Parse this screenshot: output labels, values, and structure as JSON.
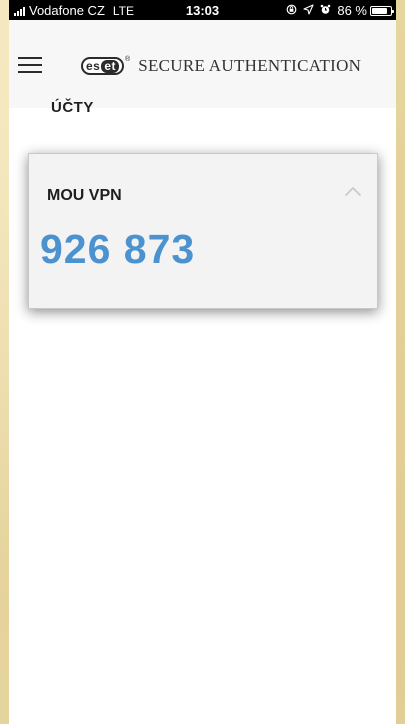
{
  "status_bar": {
    "carrier": "Vodafone CZ",
    "network": "LTE",
    "time": "13:03",
    "icons": [
      "screen-rotation-lock-icon",
      "location-arrow-icon",
      "alarm-icon"
    ],
    "battery_percent": "86 %",
    "battery_level": 0.86
  },
  "header": {
    "logo_es": "es",
    "logo_et": "et",
    "logo_reg": "®",
    "title": "SECURE AUTHENTICATION",
    "menu_icon": "hamburger-menu-icon"
  },
  "accounts": {
    "section_title": "ÚČTY",
    "items": [
      {
        "name": "MOU VPN",
        "code": "926 873",
        "expanded": true
      }
    ]
  },
  "colors": {
    "code_color": "#4b92cf",
    "status_bar_bg": "#000000",
    "header_bg": "#f7f7f7",
    "card_bg": "#f3f3f3"
  }
}
